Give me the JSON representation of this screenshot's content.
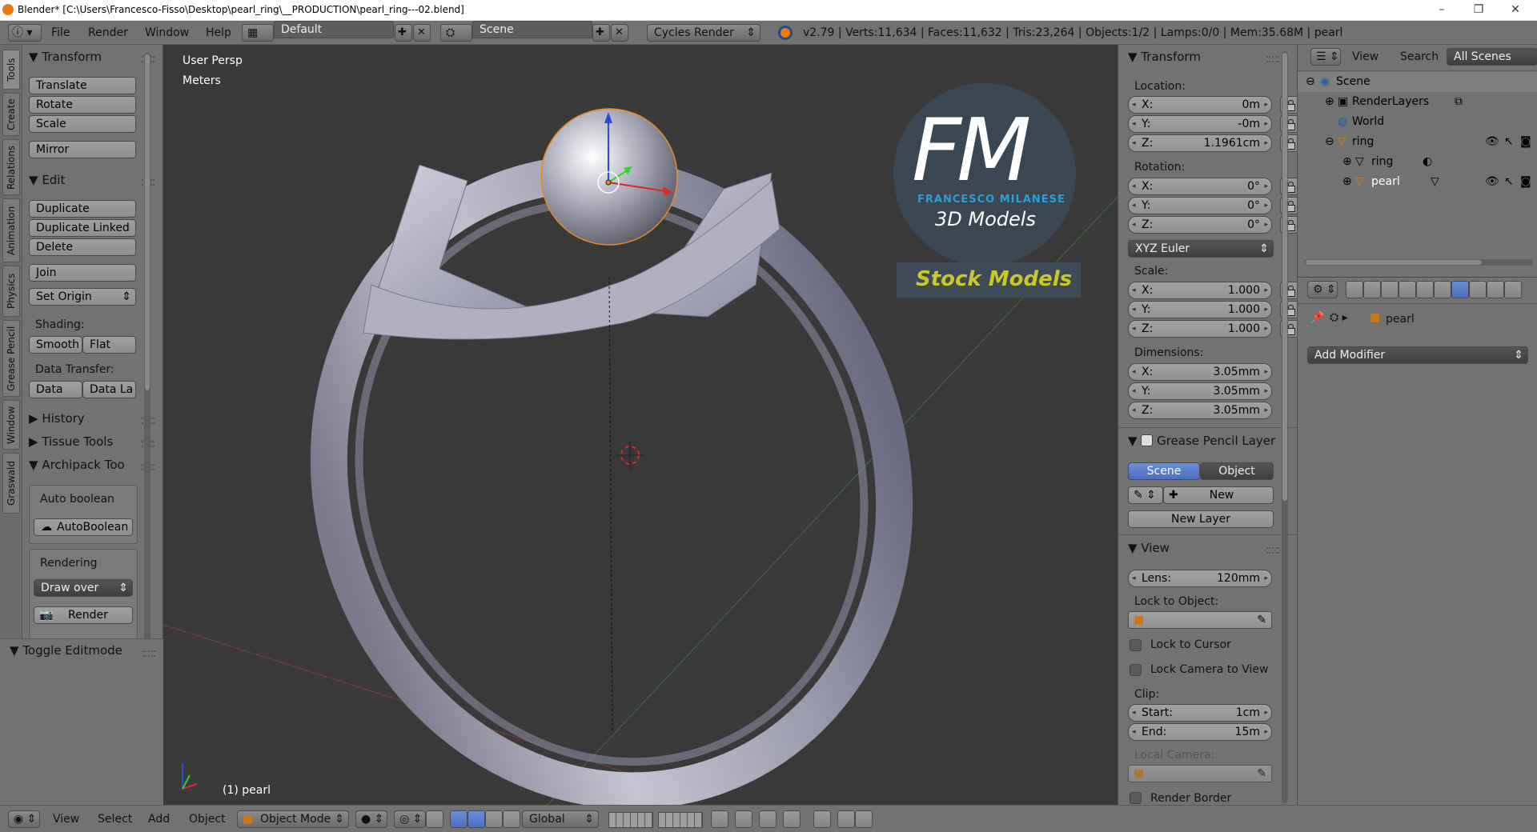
{
  "window": {
    "title": "Blender* [C:\\Users\\Francesco-Fisso\\Desktop\\pearl_ring\\__PRODUCTION\\pearl_ring---02.blend]",
    "controls": [
      "–",
      "❐",
      "✕"
    ]
  },
  "menubar": {
    "menus": [
      "File",
      "Render",
      "Window",
      "Help"
    ],
    "layout": "Default",
    "scene": "Scene",
    "engine": "Cycles Render",
    "stats": "v2.79 | Verts:11,634 | Faces:11,632 | Tris:23,264 | Objects:1/2 | Lamps:0/0 | Mem:35.68M | pearl"
  },
  "tooltabs": [
    "Tools",
    "Create",
    "Relations",
    "Animation",
    "Physics",
    "Grease Pencil",
    "Window",
    "Graswald"
  ],
  "toolshelf": {
    "transform": {
      "title": "Transform",
      "buttons": [
        "Translate",
        "Rotate",
        "Scale",
        "Mirror"
      ]
    },
    "edit": {
      "title": "Edit",
      "buttons": [
        "Duplicate",
        "Duplicate Linked",
        "Delete",
        "Join"
      ],
      "set_origin": "Set Origin"
    },
    "shading": {
      "label": "Shading:",
      "smooth": "Smooth",
      "flat": "Flat"
    },
    "data_transfer": {
      "label": "Data Transfer:",
      "data": "Data",
      "data_la": "Data La"
    },
    "history": "History",
    "tissue": "Tissue Tools",
    "archipack": "Archipack Too",
    "auto_boolean_label": "Auto boolean",
    "auto_boolean_btn": "AutoBoolean",
    "rendering_label": "Rendering",
    "draw_over": "Draw over",
    "render_btn": "Render",
    "toggle_editmode": "Toggle Editmode"
  },
  "viewport": {
    "view_name": "User Persp",
    "units": "Meters",
    "object_label": "(1) pearl",
    "logo": {
      "letters": "FM",
      "name": "FRANCESCO MILANESE",
      "sub": "3D Models",
      "stock": "Stock Models"
    }
  },
  "npanel": {
    "transform_title": "Transform",
    "location_label": "Location:",
    "location": [
      {
        "k": "X:",
        "v": "0m"
      },
      {
        "k": "Y:",
        "v": "-0m"
      },
      {
        "k": "Z:",
        "v": "1.1961cm"
      }
    ],
    "rotation_label": "Rotation:",
    "rotation": [
      {
        "k": "X:",
        "v": "0°"
      },
      {
        "k": "Y:",
        "v": "0°"
      },
      {
        "k": "Z:",
        "v": "0°"
      }
    ],
    "rotation_mode": "XYZ Euler",
    "scale_label": "Scale:",
    "scale": [
      {
        "k": "X:",
        "v": "1.000"
      },
      {
        "k": "Y:",
        "v": "1.000"
      },
      {
        "k": "Z:",
        "v": "1.000"
      }
    ],
    "dimensions_label": "Dimensions:",
    "dimensions": [
      {
        "k": "X:",
        "v": "3.05mm"
      },
      {
        "k": "Y:",
        "v": "3.05mm"
      },
      {
        "k": "Z:",
        "v": "3.05mm"
      }
    ],
    "gp_title": "Grease Pencil Layer",
    "gp_scene": "Scene",
    "gp_object": "Object",
    "gp_new": "New",
    "gp_new_layer": "New Layer",
    "view_title": "View",
    "lens": {
      "k": "Lens:",
      "v": "120mm"
    },
    "lock_to_object": "Lock to Object:",
    "lock_to_cursor": "Lock to Cursor",
    "lock_camera": "Lock Camera to View",
    "clip_label": "Clip:",
    "clip_start": {
      "k": "Start:",
      "v": "1cm"
    },
    "clip_end": {
      "k": "End:",
      "v": "15m"
    },
    "local_camera": "Local Camera:",
    "render_border": "Render Border"
  },
  "outliner": {
    "view": "View",
    "search": "Search",
    "filter": "All Scenes",
    "tree": [
      "Scene",
      "RenderLayers",
      "World",
      "ring",
      "ring",
      "pearl"
    ]
  },
  "properties": {
    "object": "pearl",
    "add_modifier": "Add Modifier"
  },
  "bottombar": {
    "menus": [
      "View",
      "Select",
      "Add",
      "Object"
    ],
    "mode": "Object Mode",
    "orientation": "Global"
  },
  "colors": {
    "accent": "#5680c2",
    "logo_blue": "#2a9fd6",
    "stock_yellow": "#c8c82a",
    "selection_orange": "#e88a2a"
  }
}
